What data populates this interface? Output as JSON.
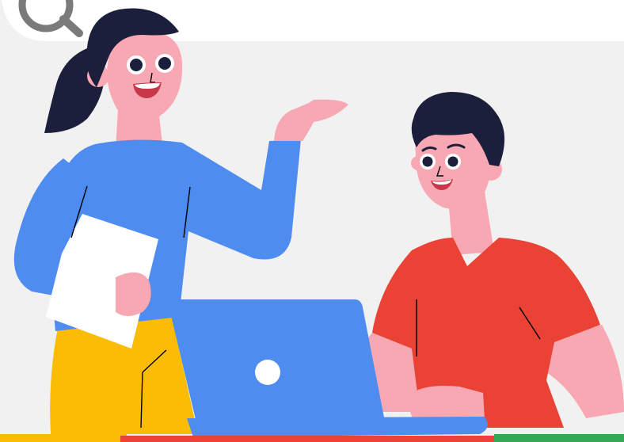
{
  "illustration": {
    "colors": {
      "background": "#f1f1f1",
      "search_bar": "#ffffff",
      "search_icon": "#7a7a7a",
      "skin": "#f7a8b3",
      "hair": "#1c1f3b",
      "woman_shirt": "#4f8cf0",
      "woman_pants": "#fbbc05",
      "man_shirt": "#ea4335",
      "laptop": "#4f8cf0",
      "laptop_logo": "#ffffff",
      "paper": "#ffffff",
      "stripe_yellow": "#fbbc05",
      "stripe_red": "#ea4335",
      "stripe_green": "#34a853",
      "mouth": "#ffffff",
      "lips": "#c7384a"
    },
    "icons": [
      "search-icon",
      "laptop-logo-icon"
    ]
  }
}
